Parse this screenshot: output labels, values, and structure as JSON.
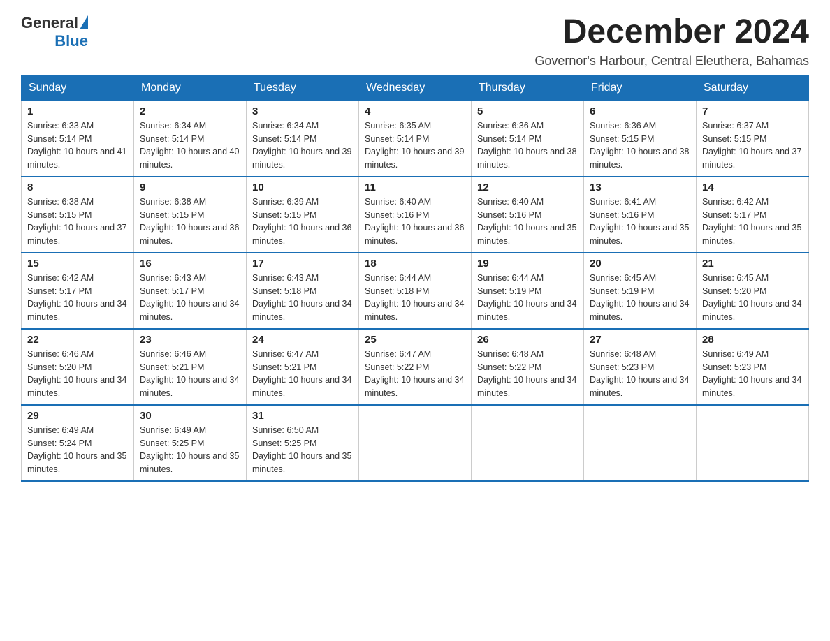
{
  "logo": {
    "general": "General",
    "blue": "Blue"
  },
  "title": "December 2024",
  "location": "Governor's Harbour, Central Eleuthera, Bahamas",
  "weekdays": [
    "Sunday",
    "Monday",
    "Tuesday",
    "Wednesday",
    "Thursday",
    "Friday",
    "Saturday"
  ],
  "weeks": [
    [
      {
        "day": "1",
        "sunrise": "6:33 AM",
        "sunset": "5:14 PM",
        "daylight": "10 hours and 41 minutes."
      },
      {
        "day": "2",
        "sunrise": "6:34 AM",
        "sunset": "5:14 PM",
        "daylight": "10 hours and 40 minutes."
      },
      {
        "day": "3",
        "sunrise": "6:34 AM",
        "sunset": "5:14 PM",
        "daylight": "10 hours and 39 minutes."
      },
      {
        "day": "4",
        "sunrise": "6:35 AM",
        "sunset": "5:14 PM",
        "daylight": "10 hours and 39 minutes."
      },
      {
        "day": "5",
        "sunrise": "6:36 AM",
        "sunset": "5:14 PM",
        "daylight": "10 hours and 38 minutes."
      },
      {
        "day": "6",
        "sunrise": "6:36 AM",
        "sunset": "5:15 PM",
        "daylight": "10 hours and 38 minutes."
      },
      {
        "day": "7",
        "sunrise": "6:37 AM",
        "sunset": "5:15 PM",
        "daylight": "10 hours and 37 minutes."
      }
    ],
    [
      {
        "day": "8",
        "sunrise": "6:38 AM",
        "sunset": "5:15 PM",
        "daylight": "10 hours and 37 minutes."
      },
      {
        "day": "9",
        "sunrise": "6:38 AM",
        "sunset": "5:15 PM",
        "daylight": "10 hours and 36 minutes."
      },
      {
        "day": "10",
        "sunrise": "6:39 AM",
        "sunset": "5:15 PM",
        "daylight": "10 hours and 36 minutes."
      },
      {
        "day": "11",
        "sunrise": "6:40 AM",
        "sunset": "5:16 PM",
        "daylight": "10 hours and 36 minutes."
      },
      {
        "day": "12",
        "sunrise": "6:40 AM",
        "sunset": "5:16 PM",
        "daylight": "10 hours and 35 minutes."
      },
      {
        "day": "13",
        "sunrise": "6:41 AM",
        "sunset": "5:16 PM",
        "daylight": "10 hours and 35 minutes."
      },
      {
        "day": "14",
        "sunrise": "6:42 AM",
        "sunset": "5:17 PM",
        "daylight": "10 hours and 35 minutes."
      }
    ],
    [
      {
        "day": "15",
        "sunrise": "6:42 AM",
        "sunset": "5:17 PM",
        "daylight": "10 hours and 34 minutes."
      },
      {
        "day": "16",
        "sunrise": "6:43 AM",
        "sunset": "5:17 PM",
        "daylight": "10 hours and 34 minutes."
      },
      {
        "day": "17",
        "sunrise": "6:43 AM",
        "sunset": "5:18 PM",
        "daylight": "10 hours and 34 minutes."
      },
      {
        "day": "18",
        "sunrise": "6:44 AM",
        "sunset": "5:18 PM",
        "daylight": "10 hours and 34 minutes."
      },
      {
        "day": "19",
        "sunrise": "6:44 AM",
        "sunset": "5:19 PM",
        "daylight": "10 hours and 34 minutes."
      },
      {
        "day": "20",
        "sunrise": "6:45 AM",
        "sunset": "5:19 PM",
        "daylight": "10 hours and 34 minutes."
      },
      {
        "day": "21",
        "sunrise": "6:45 AM",
        "sunset": "5:20 PM",
        "daylight": "10 hours and 34 minutes."
      }
    ],
    [
      {
        "day": "22",
        "sunrise": "6:46 AM",
        "sunset": "5:20 PM",
        "daylight": "10 hours and 34 minutes."
      },
      {
        "day": "23",
        "sunrise": "6:46 AM",
        "sunset": "5:21 PM",
        "daylight": "10 hours and 34 minutes."
      },
      {
        "day": "24",
        "sunrise": "6:47 AM",
        "sunset": "5:21 PM",
        "daylight": "10 hours and 34 minutes."
      },
      {
        "day": "25",
        "sunrise": "6:47 AM",
        "sunset": "5:22 PM",
        "daylight": "10 hours and 34 minutes."
      },
      {
        "day": "26",
        "sunrise": "6:48 AM",
        "sunset": "5:22 PM",
        "daylight": "10 hours and 34 minutes."
      },
      {
        "day": "27",
        "sunrise": "6:48 AM",
        "sunset": "5:23 PM",
        "daylight": "10 hours and 34 minutes."
      },
      {
        "day": "28",
        "sunrise": "6:49 AM",
        "sunset": "5:23 PM",
        "daylight": "10 hours and 34 minutes."
      }
    ],
    [
      {
        "day": "29",
        "sunrise": "6:49 AM",
        "sunset": "5:24 PM",
        "daylight": "10 hours and 35 minutes."
      },
      {
        "day": "30",
        "sunrise": "6:49 AM",
        "sunset": "5:25 PM",
        "daylight": "10 hours and 35 minutes."
      },
      {
        "day": "31",
        "sunrise": "6:50 AM",
        "sunset": "5:25 PM",
        "daylight": "10 hours and 35 minutes."
      },
      null,
      null,
      null,
      null
    ]
  ]
}
